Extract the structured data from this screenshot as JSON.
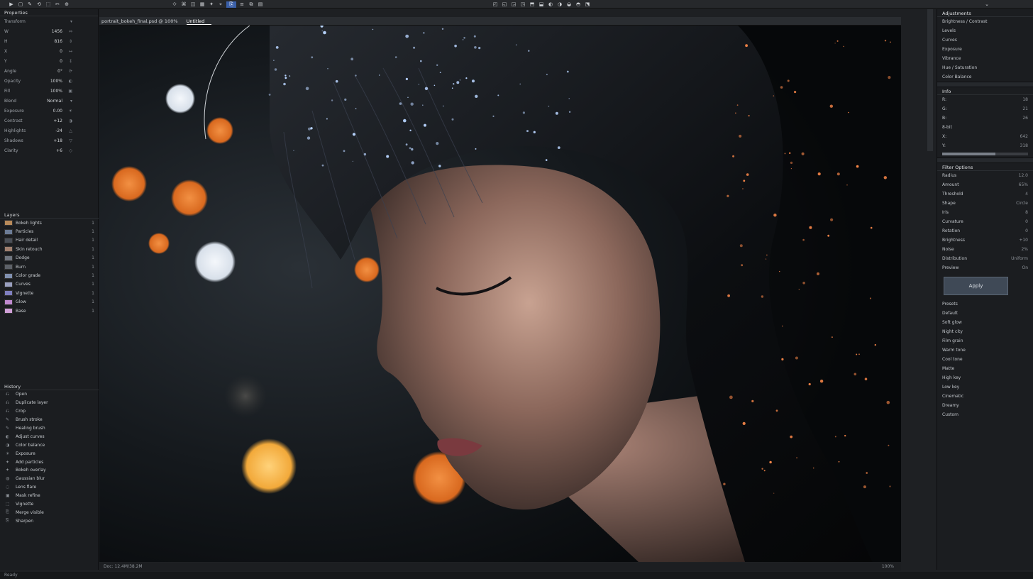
{
  "toolbar": {
    "group1": [
      "▶",
      "▢",
      "✎",
      "⟲",
      "⬚",
      "✂",
      "⊕"
    ],
    "group2": [
      "⟐",
      "⌘",
      "◫",
      "▦",
      "✦",
      "⌖",
      "⎘",
      "≡",
      "⧉",
      "▤"
    ],
    "group3": [
      "◰",
      "◱",
      "◲",
      "◳",
      "⬒",
      "⬓",
      "◐",
      "◑",
      "◒",
      "◓",
      "⬔"
    ],
    "right_icon": "⌄"
  },
  "left_panel": {
    "properties_title": "Properties",
    "properties": [
      {
        "label": "Transform",
        "value": "",
        "icon": "▾"
      },
      {
        "label": "W",
        "value": "1456",
        "icon": "⇔"
      },
      {
        "label": "H",
        "value": "816",
        "icon": "⇕"
      },
      {
        "label": "X",
        "value": "0",
        "icon": "↔"
      },
      {
        "label": "Y",
        "value": "0",
        "icon": "↕"
      },
      {
        "label": "Angle",
        "value": "0°",
        "icon": "⟳"
      },
      {
        "label": "Opacity",
        "value": "100%",
        "icon": "◐"
      },
      {
        "label": "Fill",
        "value": "100%",
        "icon": "▣"
      },
      {
        "label": "Blend",
        "value": "Normal",
        "icon": "▾"
      },
      {
        "label": "Exposure",
        "value": "0.00",
        "icon": "☀"
      },
      {
        "label": "Contrast",
        "value": "+12",
        "icon": "◑"
      },
      {
        "label": "Highlights",
        "value": "-24",
        "icon": "△"
      },
      {
        "label": "Shadows",
        "value": "+18",
        "icon": "▽"
      },
      {
        "label": "Clarity",
        "value": "+6",
        "icon": "◇"
      }
    ],
    "layers_title": "Layers",
    "layers": [
      {
        "name": "Bokeh lights",
        "count": "1",
        "color": "#b88a5a"
      },
      {
        "name": "Particles",
        "count": "1",
        "color": "#6c7c96"
      },
      {
        "name": "Hair detail",
        "count": "1",
        "color": "#4a4f57"
      },
      {
        "name": "Skin retouch",
        "count": "1",
        "color": "#a08070"
      },
      {
        "name": "Dodge",
        "count": "1",
        "color": "#707680"
      },
      {
        "name": "Burn",
        "count": "1",
        "color": "#5d6168"
      },
      {
        "name": "Color grade",
        "count": "1",
        "color": "#8090b0"
      },
      {
        "name": "Curves",
        "count": "1",
        "color": "#9aa0c0"
      },
      {
        "name": "Vignette",
        "count": "1",
        "color": "#7f7fbf"
      },
      {
        "name": "Glow",
        "count": "1",
        "color": "#c08ad0"
      },
      {
        "name": "Base",
        "count": "1",
        "color": "#d0a0d8"
      }
    ],
    "history_title": "History",
    "history": [
      {
        "icon": "⎌",
        "name": "Open"
      },
      {
        "icon": "⎌",
        "name": "Duplicate layer"
      },
      {
        "icon": "⎌",
        "name": "Crop"
      },
      {
        "icon": "✎",
        "name": "Brush stroke"
      },
      {
        "icon": "✎",
        "name": "Healing brush"
      },
      {
        "icon": "◐",
        "name": "Adjust curves"
      },
      {
        "icon": "◑",
        "name": "Color balance"
      },
      {
        "icon": "☀",
        "name": "Exposure"
      },
      {
        "icon": "✦",
        "name": "Add particles"
      },
      {
        "icon": "✦",
        "name": "Bokeh overlay"
      },
      {
        "icon": "◍",
        "name": "Gaussian blur"
      },
      {
        "icon": "◌",
        "name": "Lens flare"
      },
      {
        "icon": "▣",
        "name": "Mask refine"
      },
      {
        "icon": "⬚",
        "name": "Vignette"
      },
      {
        "icon": "⎘",
        "name": "Merge visible"
      },
      {
        "icon": "⎘",
        "name": "Sharpen"
      }
    ]
  },
  "document": {
    "tab_title": "portrait_bokeh_final.psd @ 100%",
    "second_tab": "Untitled",
    "status_left": "Doc: 12.4M/38.2M",
    "status_right": "100%"
  },
  "right_panel": {
    "adjust_title": "Adjustments",
    "adjust_rows": [
      {
        "key": "Brightness / Contrast",
        "val": ""
      },
      {
        "key": "Levels",
        "val": ""
      },
      {
        "key": "Curves",
        "val": ""
      },
      {
        "key": "Exposure",
        "val": ""
      },
      {
        "key": "Vibrance",
        "val": ""
      },
      {
        "key": "Hue / Saturation",
        "val": ""
      },
      {
        "key": "Color Balance",
        "val": ""
      }
    ],
    "info_title": "Info",
    "info_rows": [
      {
        "key": "R:",
        "val": "18"
      },
      {
        "key": "G:",
        "val": "21"
      },
      {
        "key": "B:",
        "val": "26"
      },
      {
        "key": "8-bit",
        "val": ""
      },
      {
        "key": "X:",
        "val": "642"
      },
      {
        "key": "Y:",
        "val": "318"
      }
    ],
    "slider_fraction": 0.62,
    "props_title": "Filter Options",
    "props_rows": [
      {
        "key": "Radius",
        "val": "12.0"
      },
      {
        "key": "Amount",
        "val": "65%"
      },
      {
        "key": "Threshold",
        "val": "4"
      },
      {
        "key": "Shape",
        "val": "Circle"
      },
      {
        "key": "Iris",
        "val": "8"
      },
      {
        "key": "Curvature",
        "val": "0"
      },
      {
        "key": "Rotation",
        "val": "0"
      },
      {
        "key": "Brightness",
        "val": "+10"
      },
      {
        "key": "Noise",
        "val": "2%"
      },
      {
        "key": "Distribution",
        "val": "Uniform"
      },
      {
        "key": "Preview",
        "val": "On"
      }
    ],
    "apply_label": "Apply",
    "more_rows": [
      {
        "key": "Presets",
        "val": ""
      },
      {
        "key": "Default",
        "val": ""
      },
      {
        "key": "Soft glow",
        "val": ""
      },
      {
        "key": "Night city",
        "val": ""
      },
      {
        "key": "Film grain",
        "val": ""
      },
      {
        "key": "Warm tone",
        "val": ""
      },
      {
        "key": "Cool tone",
        "val": ""
      },
      {
        "key": "Matte",
        "val": ""
      },
      {
        "key": "High key",
        "val": ""
      },
      {
        "key": "Low key",
        "val": ""
      },
      {
        "key": "Cinematic",
        "val": ""
      },
      {
        "key": "Dreamy",
        "val": ""
      },
      {
        "key": "Custom",
        "val": ""
      }
    ]
  },
  "bottom_bar": "Ready",
  "colors": {
    "bokeh_orange": "#e37a2a",
    "bokeh_gold": "#f3b24a",
    "bokeh_white": "#e6ecf3",
    "sparkle_blue": "#b8d4ff",
    "sparkle_warm": "#ff8a4a"
  }
}
